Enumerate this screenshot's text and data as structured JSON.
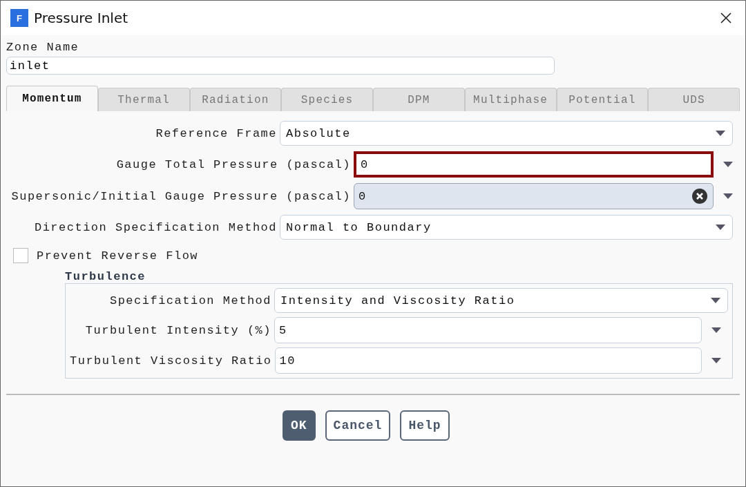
{
  "window": {
    "icon_letter": "F",
    "title": "Pressure Inlet"
  },
  "zone_name": {
    "label": "Zone Name",
    "value": "inlet"
  },
  "tabs": [
    {
      "label": "Momentum",
      "selected": true
    },
    {
      "label": "Thermal",
      "selected": false
    },
    {
      "label": "Radiation",
      "selected": false
    },
    {
      "label": "Species",
      "selected": false
    },
    {
      "label": "DPM",
      "selected": false
    },
    {
      "label": "Multiphase",
      "selected": false
    },
    {
      "label": "Potential",
      "selected": false
    },
    {
      "label": "UDS",
      "selected": false
    }
  ],
  "fields": [
    {
      "kind": "dropdown",
      "label": "Reference Frame",
      "value": "Absolute"
    },
    {
      "kind": "number",
      "label": "Gauge Total Pressure (pascal)",
      "value": "0",
      "highlighted": true
    },
    {
      "kind": "number-clear",
      "label": "Supersonic/Initial Gauge Pressure (pascal)",
      "value": "0",
      "highlighted": false
    },
    {
      "kind": "dropdown",
      "label": "Direction Specification Method",
      "value": "Normal to Boundary"
    }
  ],
  "prevent_reverse_flow": {
    "label": "Prevent Reverse Flow",
    "checked": false
  },
  "turbulence": {
    "title": "Turbulence",
    "fields": [
      {
        "kind": "dropdown",
        "label": "Specification Method",
        "value": "Intensity and Viscosity Ratio"
      },
      {
        "kind": "number",
        "label": "Turbulent Intensity (%)",
        "value": "5"
      },
      {
        "kind": "number",
        "label": "Turbulent Viscosity Ratio",
        "value": "10"
      }
    ]
  },
  "buttons": [
    {
      "label": "OK",
      "primary": true
    },
    {
      "label": "Cancel",
      "primary": false
    },
    {
      "label": "Help",
      "primary": false
    }
  ]
}
